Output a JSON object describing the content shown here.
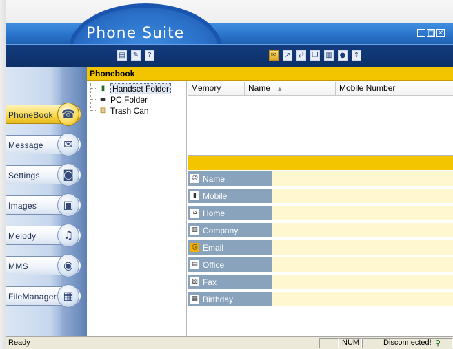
{
  "window": {
    "title": "Phone Suite",
    "controls": {
      "minimize": "▁",
      "maximize": "□",
      "close": "✕"
    }
  },
  "toolbar": {
    "left_icons": [
      "new-record-icon",
      "edit-record-icon",
      "help-icon"
    ],
    "right_icons": [
      "open-folder-icon",
      "send-icon",
      "sync-icon",
      "copy-icon",
      "book-icon",
      "settings-icon",
      "transfer-icon"
    ]
  },
  "nav": {
    "items": [
      {
        "label": "PhoneBook",
        "icon": "phone-icon",
        "active": true
      },
      {
        "label": "Message",
        "icon": "envelope-icon",
        "active": false
      },
      {
        "label": "Settings",
        "icon": "camera-icon",
        "active": false
      },
      {
        "label": "Images",
        "icon": "image-icon",
        "active": false
      },
      {
        "label": "Melody",
        "icon": "saxophone-icon",
        "active": false
      },
      {
        "label": "MMS",
        "icon": "balloon-icon",
        "active": false
      },
      {
        "label": "FileManager",
        "icon": "box-icon",
        "active": false
      }
    ]
  },
  "phonebook": {
    "header": "Phonebook",
    "tree": [
      {
        "label": "Handset Folder",
        "icon": "handset-icon",
        "selected": true
      },
      {
        "label": "PC Folder",
        "icon": "pc-icon",
        "selected": false
      },
      {
        "label": "Trash Can",
        "icon": "trash-icon",
        "selected": false
      }
    ],
    "columns": [
      "Memory",
      "Name",
      "Mobile Number"
    ],
    "sort_indicator": "▲",
    "fields": [
      {
        "label": "Name",
        "icon": "name-icon"
      },
      {
        "label": "Mobile",
        "icon": "mobile-icon"
      },
      {
        "label": "Home",
        "icon": "home-icon"
      },
      {
        "label": "Company",
        "icon": "company-icon"
      },
      {
        "label": "Email",
        "icon": "email-icon"
      },
      {
        "label": "Office",
        "icon": "office-icon"
      },
      {
        "label": "Fax",
        "icon": "fax-icon"
      },
      {
        "label": "Birthday",
        "icon": "birthday-icon"
      }
    ]
  },
  "status": {
    "text": "Ready",
    "num": "NUM",
    "connection": "Disconnected!"
  },
  "colors": {
    "accent_yellow": "#f3c400",
    "field_label_bg": "#8aa3bd",
    "field_value_bg": "#fff7cf",
    "title_blue": "#2b76cf",
    "toolbar_navy": "#123c7e"
  }
}
